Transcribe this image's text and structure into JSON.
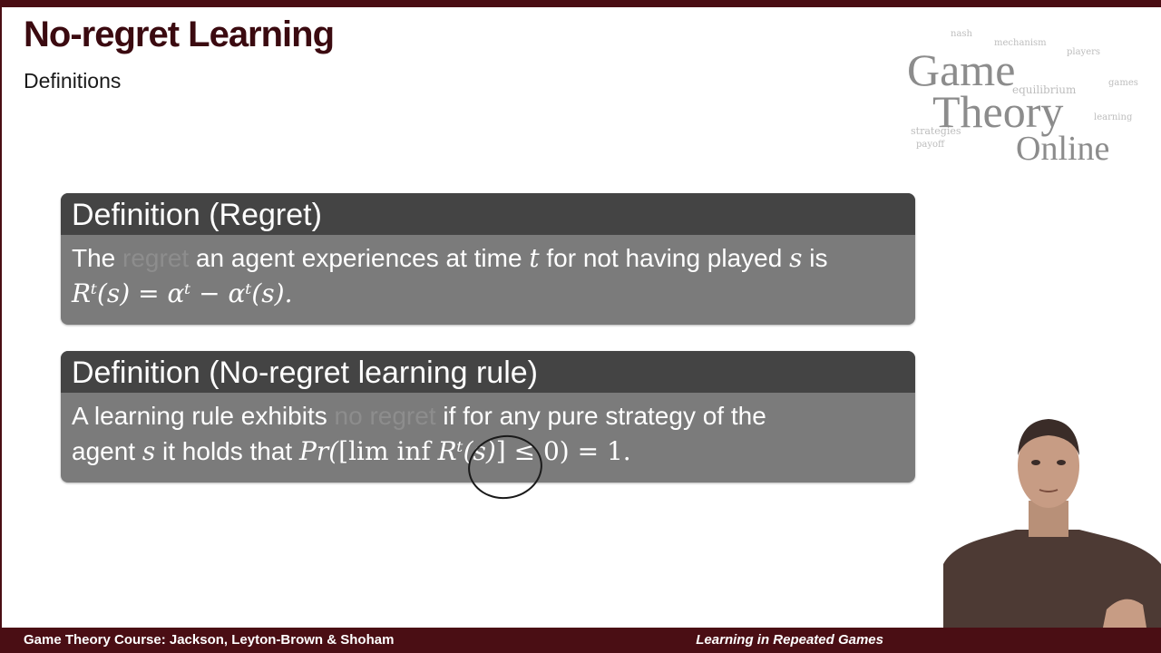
{
  "slide": {
    "title": "No-regret Learning",
    "subtitle": "Definitions"
  },
  "logo": {
    "line1": "Game",
    "line2": "Theory",
    "line3": "Online",
    "cloud_words": [
      "equilibrium",
      "strategies",
      "learning",
      "players",
      "games",
      "mechanism",
      "payoff",
      "nash"
    ]
  },
  "definition_regret": {
    "title": "Definition (Regret)",
    "text_1": "The",
    "highlight": "regret",
    "text_2": "an agent experiences at time",
    "var_t": "t",
    "text_3": "for not having played",
    "var_s": "s",
    "text_4": "is",
    "formula": "Rᵗ(s) = αᵗ − αᵗ(s)."
  },
  "definition_norule": {
    "title": "Definition (No-regret learning rule)",
    "text_1": "A learning rule exhibits",
    "highlight": "no regret",
    "text_2": "if for any pure strategy of the",
    "text_3": "agent",
    "var_s": "s",
    "text_4": "it holds that",
    "formula_pr": "Pr(",
    "formula_lim": "[lim inf",
    "formula_r": "Rᵗ(s)",
    "formula_end": "] ≤ 0) = 1."
  },
  "footer": {
    "left": "Game Theory Course: Jackson, Leyton-Brown & Shoham",
    "right": "Learning in Repeated Games"
  },
  "colors": {
    "brand": "#4a0e14",
    "box_header": "#444444",
    "box_body": "#7b7b7b"
  }
}
